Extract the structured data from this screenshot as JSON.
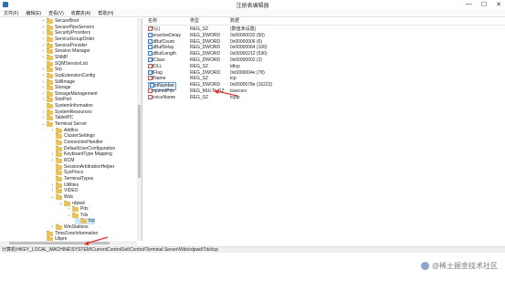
{
  "window": {
    "title": "注册表编辑器",
    "min": "—",
    "max": "☐",
    "close": "✕"
  },
  "menu": [
    "文件(F)",
    "编辑(E)",
    "查看(V)",
    "收藏夹(A)",
    "帮助(H)"
  ],
  "tree": [
    {
      "label": "SecureBoot",
      "chev": "›"
    },
    {
      "label": "SecurePipeServers",
      "chev": "›"
    },
    {
      "label": "SecurityProviders",
      "chev": "›"
    },
    {
      "label": "ServiceGroupOrder",
      "chev": "›"
    },
    {
      "label": "ServiceProvider",
      "chev": "›"
    },
    {
      "label": "Session Manager",
      "chev": "›"
    },
    {
      "label": "SNMP",
      "chev": "›"
    },
    {
      "label": "SQMServiceList",
      "chev": ""
    },
    {
      "label": "Srp",
      "chev": "›"
    },
    {
      "label": "SrpExtensionConfig",
      "chev": "›"
    },
    {
      "label": "StillImage",
      "chev": "›"
    },
    {
      "label": "Storage",
      "chev": "›"
    },
    {
      "label": "StorageManagement",
      "chev": "›"
    },
    {
      "label": "StorPort",
      "chev": "›"
    },
    {
      "label": "SystemInformation",
      "chev": ""
    },
    {
      "label": "SystemResources",
      "chev": "›"
    },
    {
      "label": "TabletPC",
      "chev": "›"
    },
    {
      "label": "Terminal Server",
      "chev": "⌄"
    },
    {
      "label": "AddIns",
      "chev": "›"
    },
    {
      "label": "ClusterSettings",
      "chev": ""
    },
    {
      "label": "ConnectionHandler",
      "chev": ""
    },
    {
      "label": "DefaultUserConfiguration",
      "chev": ""
    },
    {
      "label": "KeyboardType Mapping",
      "chev": "›"
    },
    {
      "label": "RCM",
      "chev": "›"
    },
    {
      "label": "SessionArbitrationHelper",
      "chev": ""
    },
    {
      "label": "SysProcs",
      "chev": ""
    },
    {
      "label": "TerminalTypes",
      "chev": ""
    },
    {
      "label": "Utilities",
      "chev": "›"
    },
    {
      "label": "VIDEO",
      "chev": "›"
    },
    {
      "label": "Wds",
      "chev": "⌄"
    },
    {
      "label": "rdpwd",
      "chev": "⌄"
    },
    {
      "label": "Pds",
      "chev": "›"
    },
    {
      "label": "Tds",
      "chev": "⌄"
    },
    {
      "label": "tcp",
      "chev": ""
    },
    {
      "label": "WinStations",
      "chev": "›"
    },
    {
      "label": "TimeZoneInformation",
      "chev": ""
    },
    {
      "label": "Ubpm",
      "chev": ""
    }
  ],
  "columns": {
    "name": "名称",
    "type": "类型",
    "data": "数据"
  },
  "values": [
    {
      "name": "(默认)",
      "type": "REG_SZ",
      "data": "(数值未设置)",
      "kind": "str"
    },
    {
      "name": "InteractiveDelay",
      "type": "REG_DWORD",
      "data": "0x00000032 (50)",
      "kind": "num"
    },
    {
      "name": "OutBufCount",
      "type": "REG_DWORD",
      "data": "0x00000006 (6)",
      "kind": "num"
    },
    {
      "name": "OutBufDelay",
      "type": "REG_DWORD",
      "data": "0x00000064 (100)",
      "kind": "num"
    },
    {
      "name": "OutBufLength",
      "type": "REG_DWORD",
      "data": "0x00000212 (530)",
      "kind": "num"
    },
    {
      "name": "PdClass",
      "type": "REG_DWORD",
      "data": "0x00000002 (2)",
      "kind": "num"
    },
    {
      "name": "PdDLL",
      "type": "REG_SZ",
      "data": "tdtcp",
      "kind": "str"
    },
    {
      "name": "PdFlag",
      "type": "REG_DWORD",
      "data": "0x0000004e (78)",
      "kind": "num"
    },
    {
      "name": "PdName",
      "type": "REG_SZ",
      "data": "tcp",
      "kind": "str"
    },
    {
      "name": "PortNumber",
      "type": "REG_DWORD",
      "data": "0x0000578e (16222)",
      "kind": "num"
    },
    {
      "name": "RequiredPds",
      "type": "REG_MULTI_SZ",
      "data": "tssecsrv",
      "kind": "str"
    },
    {
      "name": "ServiceName",
      "type": "REG_SZ",
      "data": "tcpip",
      "kind": "str"
    }
  ],
  "status": "计算机\\HKEY_LOCAL_MACHINE\\SYSTEM\\CurrentControlSet\\Control\\Terminal Server\\Wds\\rdpwd\\Tds\\tcp",
  "watermark": "@稀土掘金技术社区",
  "colors": {
    "arrow": "#e03030",
    "selection": "#cce8ff"
  }
}
